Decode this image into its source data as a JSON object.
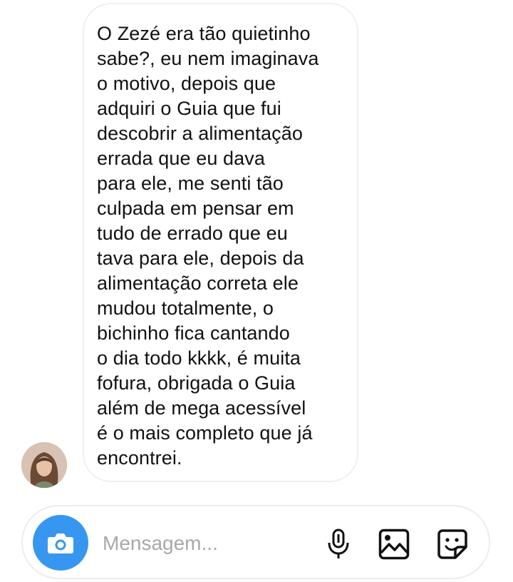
{
  "conversation": {
    "message_text": "O Zezé era tão quietinho\nsabe?, eu nem imaginava\no motivo, depois que\nadquiri o Guia que fui\ndescobrir a alimentação\nerrada que eu dava\npara ele, me senti tão\nculpada em pensar em\ntudo de errado que eu\ntava para ele, depois da\nalimentação correta ele\nmudou totalmente, o\nbichinho fica cantando\no dia todo kkkk, é muita\nfofura, obrigada o Guia\nalém de mega acessível\né o mais completo que já\nencontrei.",
    "sender_avatar": "user-avatar-photo"
  },
  "composer": {
    "placeholder": "Mensagem...",
    "value": "",
    "icons": {
      "camera": "camera-icon",
      "microphone": "microphone-icon",
      "gallery": "image-icon",
      "sticker": "sticker-icon"
    },
    "accent_color": "#3797f0"
  }
}
